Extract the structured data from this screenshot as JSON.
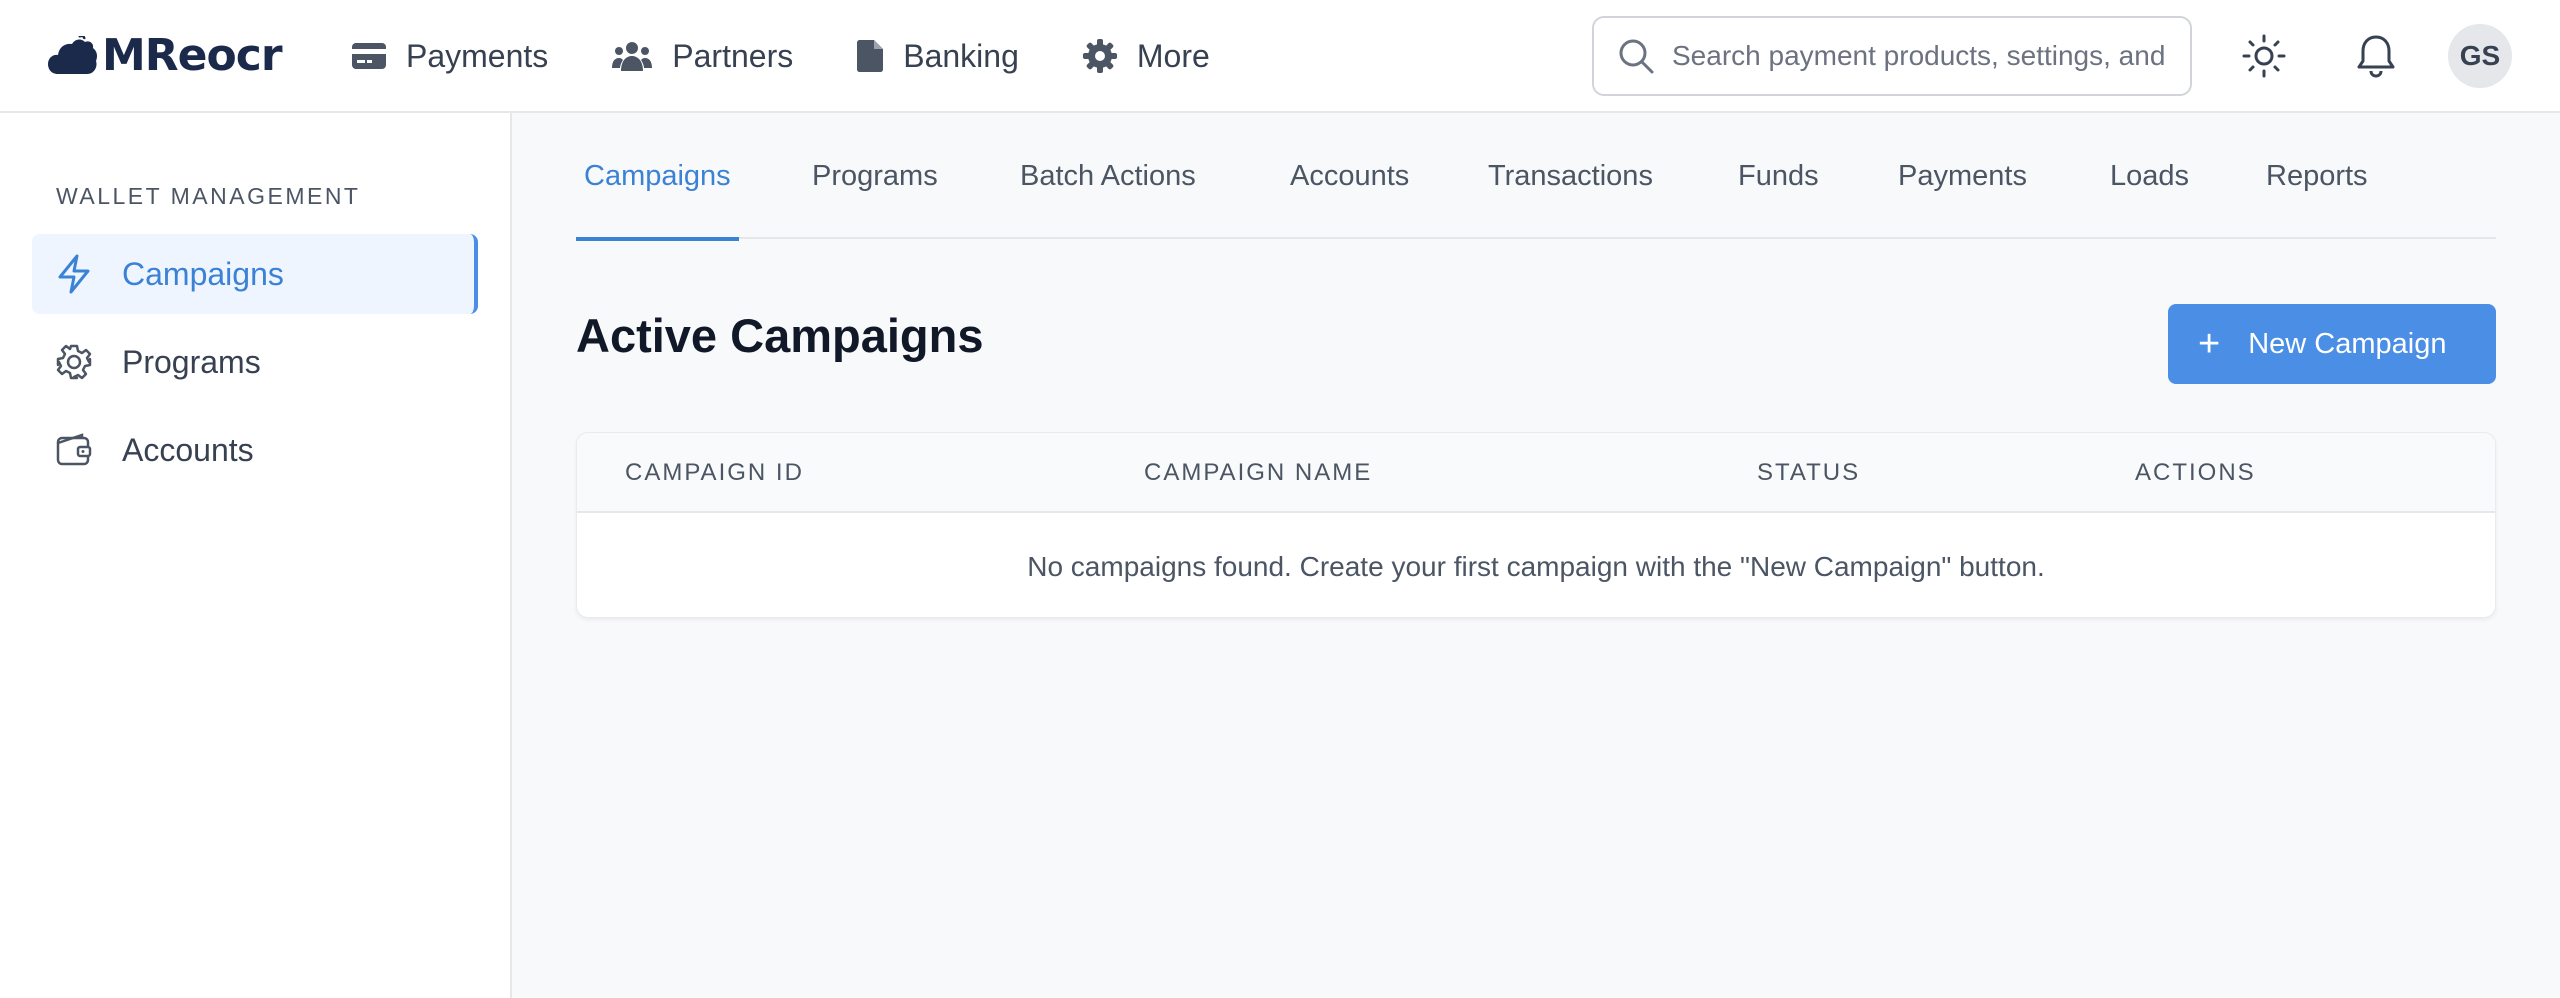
{
  "brand": {
    "name": "MReocr",
    "accent_color": "#4a8ee6",
    "logo_icon": "cloud-icon"
  },
  "topnav": {
    "items": [
      {
        "label": "Payments",
        "icon": "credit-card-icon"
      },
      {
        "label": "Partners",
        "icon": "users-icon"
      },
      {
        "label": "Banking",
        "icon": "document-icon"
      },
      {
        "label": "More",
        "icon": "gear-icon"
      }
    ]
  },
  "search": {
    "placeholder": "Search payment products, settings, and more",
    "value": ""
  },
  "header_actions": {
    "theme_icon": "sun-icon",
    "notifications_icon": "bell-icon",
    "avatar_initials": "GS"
  },
  "sidebar": {
    "heading": "WALLET MANAGEMENT",
    "items": [
      {
        "label": "Campaigns",
        "icon": "lightning-icon",
        "active": true
      },
      {
        "label": "Programs",
        "icon": "gear-icon",
        "active": false
      },
      {
        "label": "Accounts",
        "icon": "wallet-icon",
        "active": false
      }
    ]
  },
  "tabs": [
    {
      "label": "Campaigns",
      "active": true
    },
    {
      "label": "Programs"
    },
    {
      "label": "Batch Actions"
    },
    {
      "label": "Accounts"
    },
    {
      "label": "Transactions"
    },
    {
      "label": "Funds"
    },
    {
      "label": "Payments"
    },
    {
      "label": "Loads"
    },
    {
      "label": "Reports"
    }
  ],
  "main": {
    "title": "Active Campaigns",
    "new_button_label": "New Campaign",
    "new_button_icon": "plus-icon"
  },
  "table": {
    "columns": [
      "CAMPAIGN ID",
      "CAMPAIGN NAME",
      "STATUS",
      "ACTIONS"
    ],
    "empty_message": "No campaigns found. Create your first campaign with the \"New Campaign\" button."
  }
}
